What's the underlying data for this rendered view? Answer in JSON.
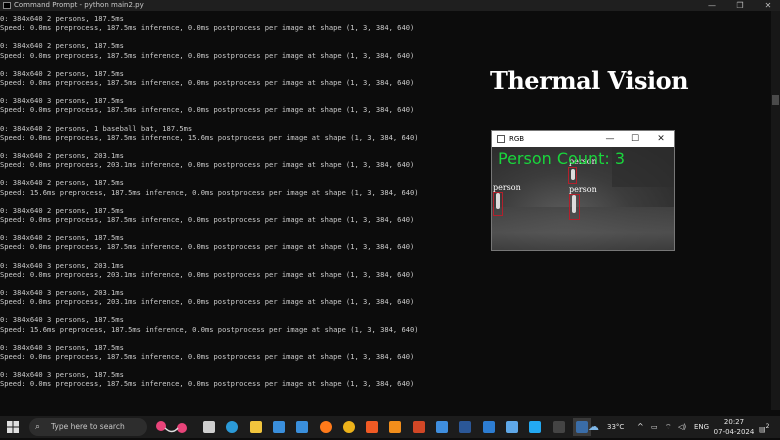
{
  "window": {
    "title": "Command Prompt - python  main2.py",
    "controls": [
      "—",
      "❐",
      "✕"
    ]
  },
  "console_lines": [
    [
      "0: 384x640 2 persons, 187.5ms",
      "Speed: 0.0ms preprocess, 187.5ms inference, 0.0ms postprocess per image at shape (1, 3, 384, 640)"
    ],
    [
      "0: 384x640 2 persons, 187.5ms",
      "Speed: 0.0ms preprocess, 187.5ms inference, 0.0ms postprocess per image at shape (1, 3, 384, 640)"
    ],
    [
      "0: 384x640 2 persons, 187.5ms",
      "Speed: 0.0ms preprocess, 187.5ms inference, 0.0ms postprocess per image at shape (1, 3, 384, 640)"
    ],
    [
      "0: 384x640 3 persons, 187.5ms",
      "Speed: 0.0ms preprocess, 187.5ms inference, 0.0ms postprocess per image at shape (1, 3, 384, 640)"
    ],
    [
      "0: 384x640 2 persons, 1 baseball bat, 187.5ms",
      "Speed: 0.0ms preprocess, 187.5ms inference, 15.6ms postprocess per image at shape (1, 3, 384, 640)"
    ],
    [
      "0: 384x640 2 persons, 203.1ms",
      "Speed: 0.0ms preprocess, 203.1ms inference, 0.0ms postprocess per image at shape (1, 3, 384, 640)"
    ],
    [
      "0: 384x640 2 persons, 187.5ms",
      "Speed: 15.6ms preprocess, 187.5ms inference, 0.0ms postprocess per image at shape (1, 3, 384, 640)"
    ],
    [
      "0: 384x640 2 persons, 187.5ms",
      "Speed: 0.0ms preprocess, 187.5ms inference, 0.0ms postprocess per image at shape (1, 3, 384, 640)"
    ],
    [
      "0: 384x640 2 persons, 187.5ms",
      "Speed: 0.0ms preprocess, 187.5ms inference, 0.0ms postprocess per image at shape (1, 3, 384, 640)"
    ],
    [
      "0: 384x640 3 persons, 203.1ms",
      "Speed: 0.0ms preprocess, 203.1ms inference, 0.0ms postprocess per image at shape (1, 3, 384, 640)"
    ],
    [
      "0: 384x640 3 persons, 203.1ms",
      "Speed: 0.0ms preprocess, 203.1ms inference, 0.0ms postprocess per image at shape (1, 3, 384, 640)"
    ],
    [
      "0: 384x640 3 persons, 187.5ms",
      "Speed: 15.6ms preprocess, 187.5ms inference, 0.0ms postprocess per image at shape (1, 3, 384, 640)"
    ],
    [
      "0: 384x640 3 persons, 187.5ms",
      "Speed: 0.0ms preprocess, 187.5ms inference, 0.0ms postprocess per image at shape (1, 3, 384, 640)"
    ],
    [
      "0: 384x640 3 persons, 187.5ms",
      "Speed: 0.0ms preprocess, 187.5ms inference, 0.0ms postprocess per image at shape (1, 3, 384, 640)"
    ]
  ],
  "overlay": {
    "heading": "Thermal Vision"
  },
  "rgb_window": {
    "title": "RGB",
    "controls": [
      "—",
      "☐",
      "✕"
    ],
    "person_count_text": "Person Count: 3",
    "detection_label": "person",
    "box_color": "#b3202c",
    "count_color": "#19d63c"
  },
  "taskbar": {
    "search_placeholder": "Type here to search",
    "weather": "33°C",
    "language": "ENG",
    "time": "20:27",
    "date": "07-04-2024",
    "notification_count": "2",
    "apps": [
      "task-view-icon",
      "edge-icon",
      "file-explorer-icon",
      "store-icon",
      "mail-icon",
      "firefox-icon",
      "chrome-icon",
      "brave-icon",
      "vlc-icon",
      "powerpoint-icon",
      "photos-icon",
      "word-icon",
      "remote-desktop-icon",
      "image-viewer-icon",
      "vscode-icon",
      "terminal-icon",
      "python-icon"
    ]
  }
}
